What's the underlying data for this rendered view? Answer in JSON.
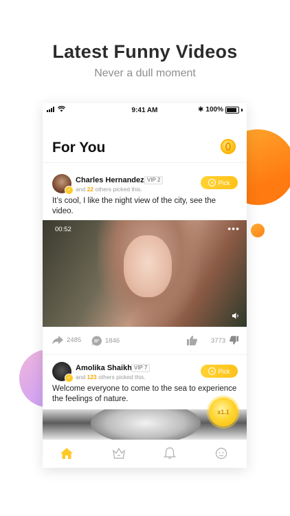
{
  "promo": {
    "title": "Latest Funny Videos",
    "subtitle": "Never a dull moment"
  },
  "status_bar": {
    "time": "9:41 AM",
    "battery": "100%"
  },
  "header": {
    "title": "For You",
    "coin_icon": "coin-icon"
  },
  "posts": [
    {
      "author": "Charles Hernandez",
      "vip": "VIP 2",
      "picked_prefix": "and",
      "picked_count": "22",
      "picked_suffix": "others picked this.",
      "pick_label": "Pick",
      "caption": "It’s cool, I like the night view of the city, see the video.",
      "video_duration": "00:52",
      "more": "•••",
      "shares": "2485",
      "comments": "1846",
      "likes": "3773"
    },
    {
      "author": "Amolika Shaikh",
      "vip": "VIP 7",
      "picked_prefix": "and",
      "picked_count": "123",
      "picked_suffix": "others picked this.",
      "pick_label": "Pick",
      "caption": "Welcome everyone to come to the sea to experience the feelings of nature."
    }
  ],
  "speed_badge": "x1.1",
  "tabs": [
    {
      "name": "home",
      "active": true
    },
    {
      "name": "crown",
      "active": false
    },
    {
      "name": "bell",
      "active": false
    },
    {
      "name": "chat",
      "active": false
    }
  ],
  "colors": {
    "accent": "#FFC926",
    "orange": "#FF8A1E",
    "purple": "#C9A3F2"
  }
}
